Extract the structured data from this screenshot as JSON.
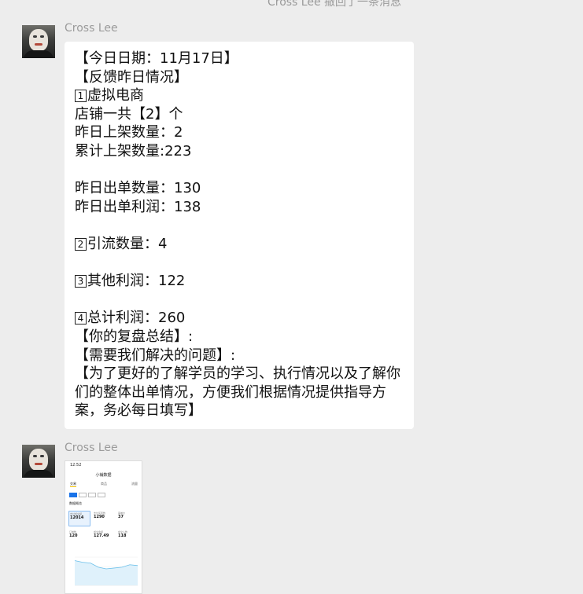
{
  "system_notice": "Cross Lee  撤回了一条消息",
  "colors": {
    "background": "#ededed",
    "bubble": "#ffffff",
    "sender_name": "#9b9b9b"
  },
  "messages": [
    {
      "sender": "Cross Lee",
      "avatar": "user-avatar",
      "type": "text",
      "lines": [
        {
          "text": "【今日日期：11月17日】"
        },
        {
          "text": "【反馈昨日情况】"
        },
        {
          "num": "1",
          "text": "虚拟电商"
        },
        {
          "text": "店铺一共【2】个"
        },
        {
          "text": "昨日上架数量：2"
        },
        {
          "text": "累计上架数量:223"
        },
        {
          "text": ""
        },
        {
          "text": "昨日出单数量：130"
        },
        {
          "text": "昨日出单利润：138"
        },
        {
          "text": ""
        },
        {
          "num": "2",
          "text": "引流数量：4"
        },
        {
          "text": ""
        },
        {
          "num": "3",
          "text": "其他利润：122"
        },
        {
          "text": ""
        },
        {
          "num": "4",
          "text": "总计利润：260"
        },
        {
          "text": "【你的复盘总结】:"
        },
        {
          "text": "【需要我们解决的问题】:"
        },
        {
          "text": "【为了更好的了解学员的学习、执行情况以及了解你们的整体出单情况，方便我们根据情况提供指导方案，务必每日填写】",
          "wrap": true
        }
      ]
    },
    {
      "sender": "Cross Lee",
      "avatar": "user-avatar",
      "type": "image",
      "image": {
        "status_time": "12:52",
        "title": "小铺数据",
        "tabs": [
          "交易",
          "商品",
          "流量"
        ],
        "section": "数据概览",
        "metrics": [
          {
            "label": "支付成交额",
            "value": "12014"
          },
          {
            "label": "支付买家数",
            "value": "1290"
          },
          {
            "label": "客单价",
            "value": "37"
          },
          {
            "label": "订单数",
            "value": "120"
          },
          {
            "label": "成交金额",
            "value": "127.49"
          },
          {
            "label": "成交人数",
            "value": "118"
          }
        ],
        "trend": [
          30,
          28,
          27,
          22,
          20,
          21,
          22,
          25,
          24
        ]
      }
    }
  ]
}
